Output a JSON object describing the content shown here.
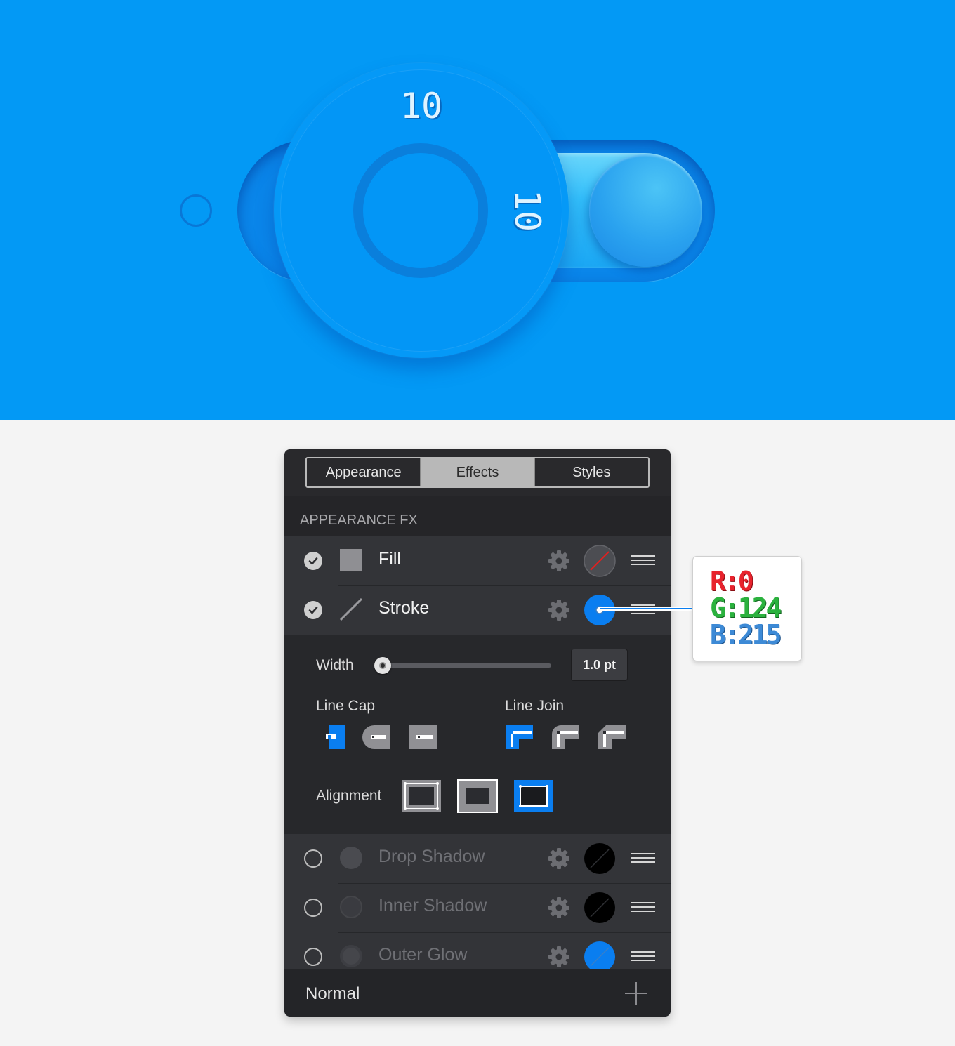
{
  "hero": {
    "dimension_top": "10",
    "dimension_right": "10"
  },
  "panel": {
    "tabs": [
      {
        "label": "Appearance",
        "active": false
      },
      {
        "label": "Effects",
        "active": true
      },
      {
        "label": "Styles",
        "active": false
      }
    ],
    "section_title": "APPEARANCE FX",
    "effects": [
      {
        "label": "Fill",
        "enabled": true
      },
      {
        "label": "Stroke",
        "enabled": true
      },
      {
        "label": "Drop Shadow",
        "enabled": false
      },
      {
        "label": "Inner Shadow",
        "enabled": false
      },
      {
        "label": "Outer Glow",
        "enabled": false
      }
    ],
    "stroke": {
      "width_label": "Width",
      "width_value": "1.0 pt",
      "line_cap_label": "Line Cap",
      "line_join_label": "Line Join",
      "alignment_label": "Alignment"
    },
    "footer": {
      "blend_mode": "Normal"
    }
  },
  "callout": {
    "r": "R:0",
    "g": "G:124",
    "b": "B:215"
  },
  "colors": {
    "background_blue": "#0399f5",
    "stroke_color": "#007cd7",
    "accent_blue": "#0a7ef0"
  }
}
